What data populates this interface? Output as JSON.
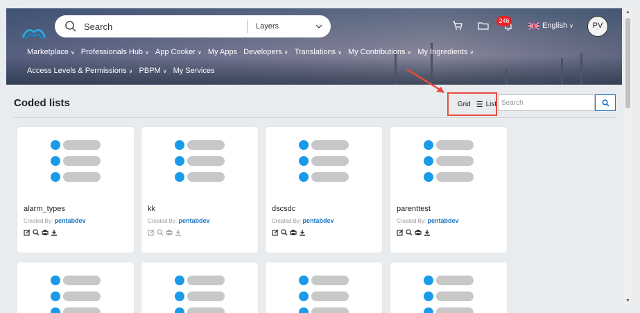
{
  "header": {
    "search_placeholder": "Search",
    "layers_label": "Layers",
    "notification_count": "246",
    "language": "English",
    "avatar_initials": "PV",
    "nav_row1": [
      "Marketplace",
      "Professionals Hub",
      "App Cooker",
      "My Apps",
      "Developers",
      "Translations",
      "My Contributions",
      "My Ingredients"
    ],
    "nav_row1_chevrons": [
      true,
      true,
      true,
      false,
      true,
      true,
      true,
      true
    ],
    "nav_row2": [
      "Access Levels & Permissions",
      "PBPM",
      "My Services"
    ],
    "nav_row2_chevrons": [
      true,
      true,
      false
    ]
  },
  "page": {
    "title": "Coded lists",
    "grid_label": "Grid",
    "list_label": "List",
    "search_placeholder": "Search"
  },
  "cards": [
    {
      "name": "alarm_types",
      "created_by_label": "Created By:",
      "creator": "pentabdev"
    },
    {
      "name": "kk",
      "created_by_label": "Created By:",
      "creator": "pentabdev"
    },
    {
      "name": "dscsdc",
      "created_by_label": "Created By:",
      "creator": "pentabdev"
    },
    {
      "name": "parenttest",
      "created_by_label": "Created By:",
      "creator": "pentabdev"
    }
  ],
  "colors": {
    "accent": "#1a9bea",
    "link": "#1a74c4",
    "highlight": "#e74c3c",
    "badge": "#e4262a"
  }
}
